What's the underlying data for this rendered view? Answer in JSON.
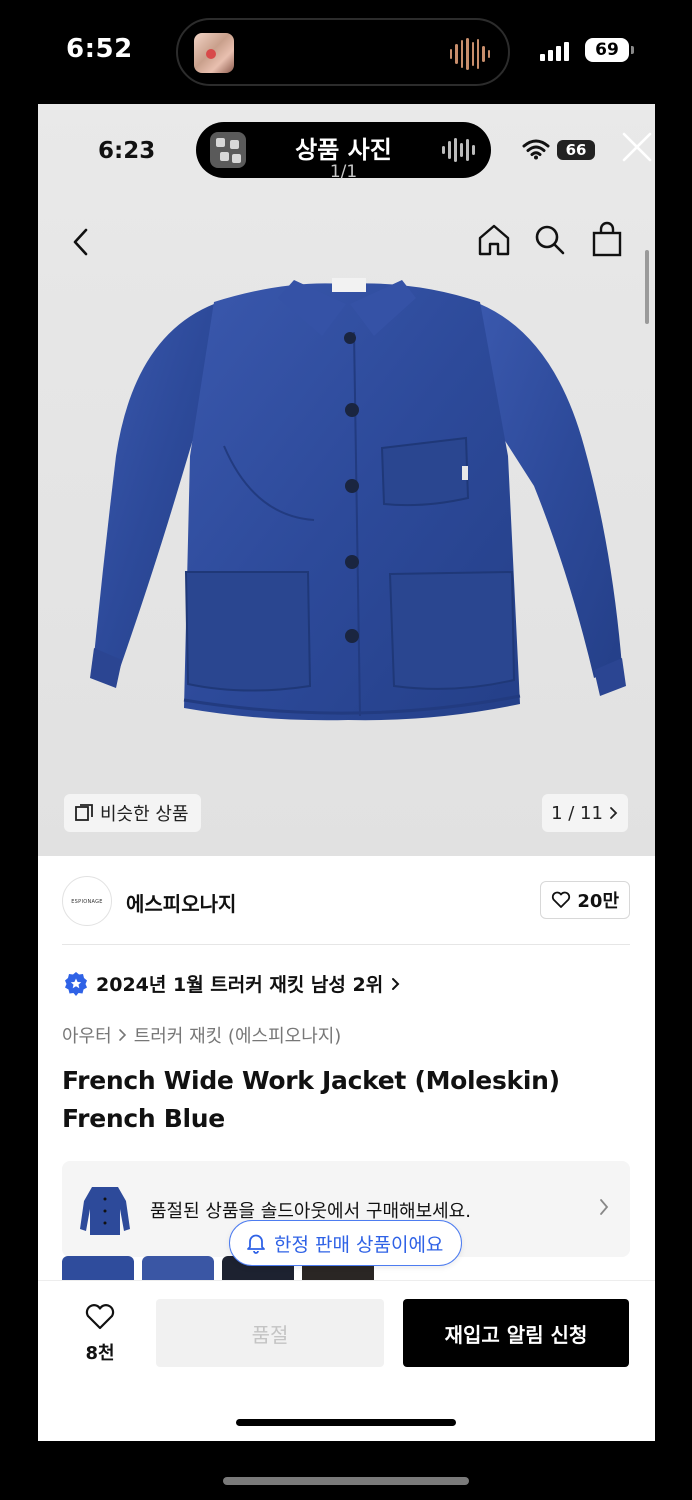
{
  "outer_status": {
    "time": "6:52",
    "battery": "69"
  },
  "inner_status": {
    "time": "6:23",
    "battery": "66"
  },
  "island": {
    "title": "상품 사진",
    "subtitle": "1/1"
  },
  "gallery": {
    "similar_label": "비슷한 상품",
    "counter": "1 / 11"
  },
  "brand": {
    "logo_text": "ESPIONAGE",
    "name": "에스피오나지",
    "likes": "20만"
  },
  "ranking": {
    "text": "2024년 1월 트러커 재킷 남성 2위"
  },
  "breadcrumb": {
    "category": "아우터",
    "subcategory": "트러커 재킷 (에스피오나지)"
  },
  "product": {
    "title": "French Wide Work Jacket (Moleskin) French Blue"
  },
  "banner": {
    "text": "품절된 상품을 솔드아웃에서 구매해보세요."
  },
  "limited_badge": {
    "text": "한정 판매 상품이에요"
  },
  "bottom_bar": {
    "wishlist_count": "8천",
    "soldout_label": "품절",
    "restock_label": "재입고 알림 신청"
  },
  "colors": {
    "accent_blue": "#2f62e6",
    "jacket_blue": "#2d4a9a",
    "primary_button": "#000000"
  }
}
